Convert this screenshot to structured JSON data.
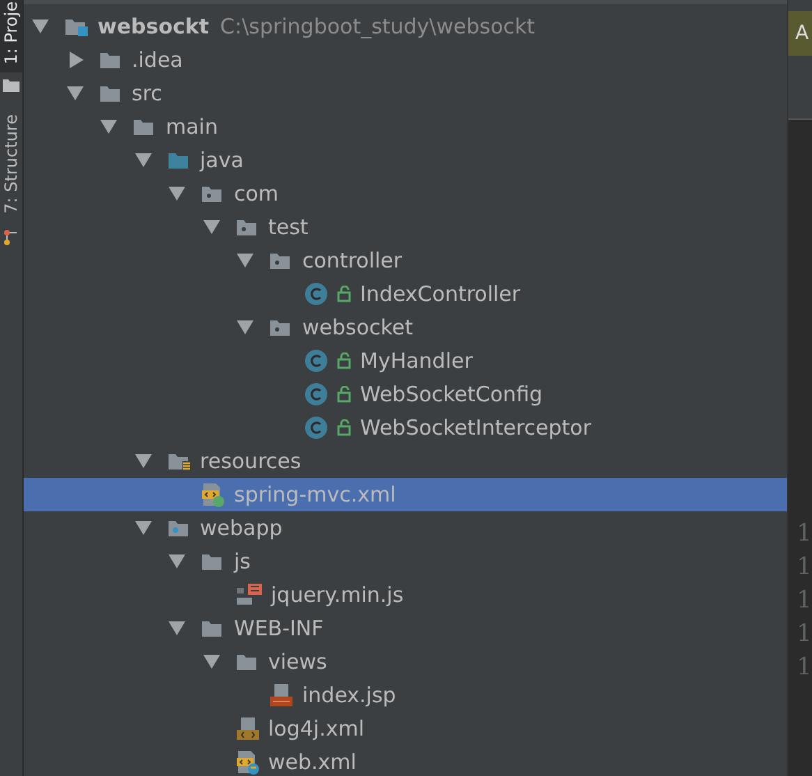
{
  "tool_windows": [
    {
      "label": "1: Proje",
      "kind": "project",
      "selected": true
    },
    {
      "label": "7: Structure",
      "kind": "structure",
      "selected": false
    }
  ],
  "project_tree": [
    {
      "label": "websockt",
      "path": "C:\\springboot_study\\websockt",
      "kind": "project",
      "expanded": true,
      "selected": false,
      "children": [
        {
          "label": ".idea",
          "kind": "folder",
          "expanded": false,
          "selected": false
        },
        {
          "label": "src",
          "kind": "folder",
          "expanded": true,
          "selected": false,
          "children": [
            {
              "label": "main",
              "kind": "folder",
              "expanded": true,
              "selected": false,
              "children": [
                {
                  "label": "java",
                  "kind": "source-folder",
                  "expanded": true,
                  "selected": false,
                  "children": [
                    {
                      "label": "com",
                      "kind": "package",
                      "expanded": true,
                      "selected": false,
                      "children": [
                        {
                          "label": "test",
                          "kind": "package",
                          "expanded": true,
                          "selected": false,
                          "children": [
                            {
                              "label": "controller",
                              "kind": "package",
                              "expanded": true,
                              "selected": false,
                              "children": [
                                {
                                  "label": "IndexController",
                                  "kind": "class",
                                  "selected": false
                                }
                              ]
                            },
                            {
                              "label": "websocket",
                              "kind": "package",
                              "expanded": true,
                              "selected": false,
                              "children": [
                                {
                                  "label": "MyHandler",
                                  "kind": "class",
                                  "selected": false
                                },
                                {
                                  "label": "WebSocketConfig",
                                  "kind": "class",
                                  "selected": false
                                },
                                {
                                  "label": "WebSocketInterceptor",
                                  "kind": "class",
                                  "selected": false
                                }
                              ]
                            }
                          ]
                        }
                      ]
                    }
                  ]
                },
                {
                  "label": "resources",
                  "kind": "resources-folder",
                  "expanded": true,
                  "selected": false,
                  "children": [
                    {
                      "label": "spring-mvc.xml",
                      "kind": "spring-xml",
                      "selected": true
                    }
                  ]
                },
                {
                  "label": "webapp",
                  "kind": "web-folder",
                  "expanded": true,
                  "selected": false,
                  "children": [
                    {
                      "label": "js",
                      "kind": "folder",
                      "expanded": true,
                      "selected": false,
                      "children": [
                        {
                          "label": "jquery.min.js",
                          "kind": "js",
                          "selected": false
                        }
                      ]
                    },
                    {
                      "label": "WEB-INF",
                      "kind": "folder",
                      "expanded": true,
                      "selected": false,
                      "children": [
                        {
                          "label": "views",
                          "kind": "folder",
                          "expanded": true,
                          "selected": false,
                          "children": [
                            {
                              "label": "index.jsp",
                              "kind": "jsp",
                              "selected": false
                            }
                          ]
                        },
                        {
                          "label": "log4j.xml",
                          "kind": "xml",
                          "selected": false
                        },
                        {
                          "label": "web.xml",
                          "kind": "web-xml",
                          "selected": false
                        }
                      ]
                    }
                  ]
                }
              ]
            }
          ]
        }
      ]
    }
  ],
  "editor": {
    "tabs": [
      {
        "label": "A",
        "selected": true
      }
    ],
    "line_numbers": [
      "1",
      "1",
      "1",
      "1",
      "1"
    ]
  }
}
